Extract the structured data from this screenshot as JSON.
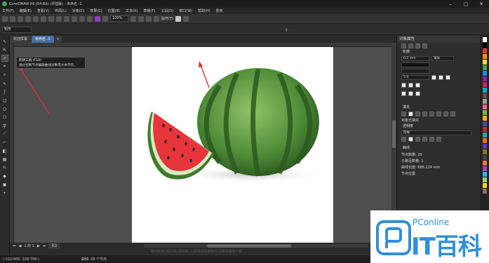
{
  "titlebar": {
    "title": "CorelDRAW X8 (64-Bit) (评估版) - 未命名 -1"
  },
  "menu": [
    "文件(F)",
    "编辑(E)",
    "查看(V)",
    "布局(L)",
    "对象(C)",
    "效果(C)",
    "位图(B)",
    "文本(X)",
    "表格(T)",
    "工具(O)",
    "窗口(W)",
    "帮助(H)",
    "购买"
  ],
  "toolbar": {
    "zoom": "100%",
    "snap_label": "贴齐(T)"
  },
  "propbar": {
    "shape_label": "矩形"
  },
  "tabs": {
    "welcome": "欢迎屏幕",
    "doc": "未命名 -1",
    "add": "+"
  },
  "tooltip": {
    "title": "形状工具 (F10)",
    "desc": "通过控制节点编辑曲线对象或文本字符。"
  },
  "panel": {
    "title": "对象属性",
    "outline_header": "轮廓",
    "outline_width": "0.2 mm",
    "outline_unit": "毫米",
    "miter": "5.0",
    "fill_header": "填充",
    "no_fill": "对象无填充",
    "transparency_header": "透明度",
    "blend": "常规",
    "curve_header": "曲线",
    "nodes": "节点数量: 29",
    "subpaths": "子路径数量: 1",
    "curve_length": "曲线长度: 686.124 mm",
    "node_position": "节点位置"
  },
  "bottom": {
    "page_info": "1 的 1",
    "page_tab": "页1",
    "hint": "拖动颜色(或对象)至此处,以便将这些颜色与文档存储在一起"
  },
  "status": {
    "coords": "(-112.005, 228.799 )",
    "curve_info": "曲线: 29 个节点"
  },
  "logo": {
    "brand": "PConline",
    "big": "IT百科"
  },
  "colors": {
    "accent": "#4a6fa5",
    "palette": [
      "#ffffff",
      "#000000",
      "#e53935",
      "#fb8c00",
      "#fdd835",
      "#43a047",
      "#1e88e5",
      "#8e24aa",
      "#d81b60",
      "#00acc1",
      "#6d4c41",
      "#9e9e9e",
      "#f06292",
      "#7cb342",
      "#ffb300",
      "#3949ab",
      "#c62828",
      "#26a69a",
      "#ef6c00",
      "#5e35b1",
      "#827717",
      "#37474f",
      "#ff7043",
      "#ab47bc",
      "#29b6f6",
      "#9ccc65",
      "#ffca28",
      "#8d6e63"
    ]
  }
}
